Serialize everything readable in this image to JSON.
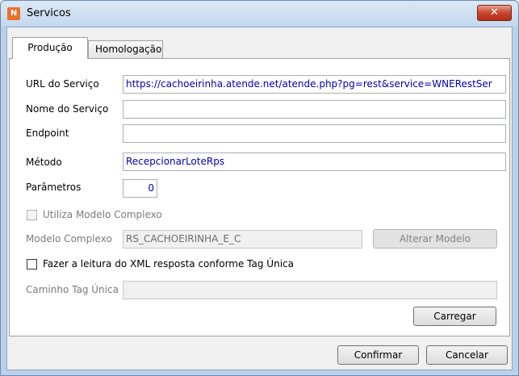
{
  "window": {
    "title": "Servicos",
    "app_icon": "app-logo-icon",
    "close_glyph": "✕"
  },
  "tabs": [
    {
      "label": "Produção",
      "active": true
    },
    {
      "label": "Homologação",
      "active": false
    }
  ],
  "form": {
    "url_label": "URL do Serviço",
    "url_value": "https://cachoeirinha.atende.net/atende.php?pg=rest&service=WNERestSer",
    "nome_label": "Nome do Serviço",
    "nome_value": "",
    "endpoint_label": "Endpoint",
    "endpoint_value": "",
    "metodo_label": "Método",
    "metodo_value": "RecepcionarLoteRps",
    "parametros_label": "Parâmetros",
    "parametros_value": "0",
    "modelo_complexo_check_label": "Utiliza Modelo Complexo",
    "modelo_complexo_label": "Modelo Complexo",
    "modelo_complexo_value": "RS_CACHOEIRINHA_E_C",
    "alterar_modelo_label": "Alterar Modelo",
    "tag_unica_check_label": "Fazer a leitura do XML resposta conforme Tag Única",
    "caminho_tag_label": "Caminho Tag Única",
    "caminho_tag_value": "",
    "carregar_label": "Carregar"
  },
  "footer": {
    "confirmar_label": "Confirmar",
    "cancelar_label": "Cancelar"
  }
}
